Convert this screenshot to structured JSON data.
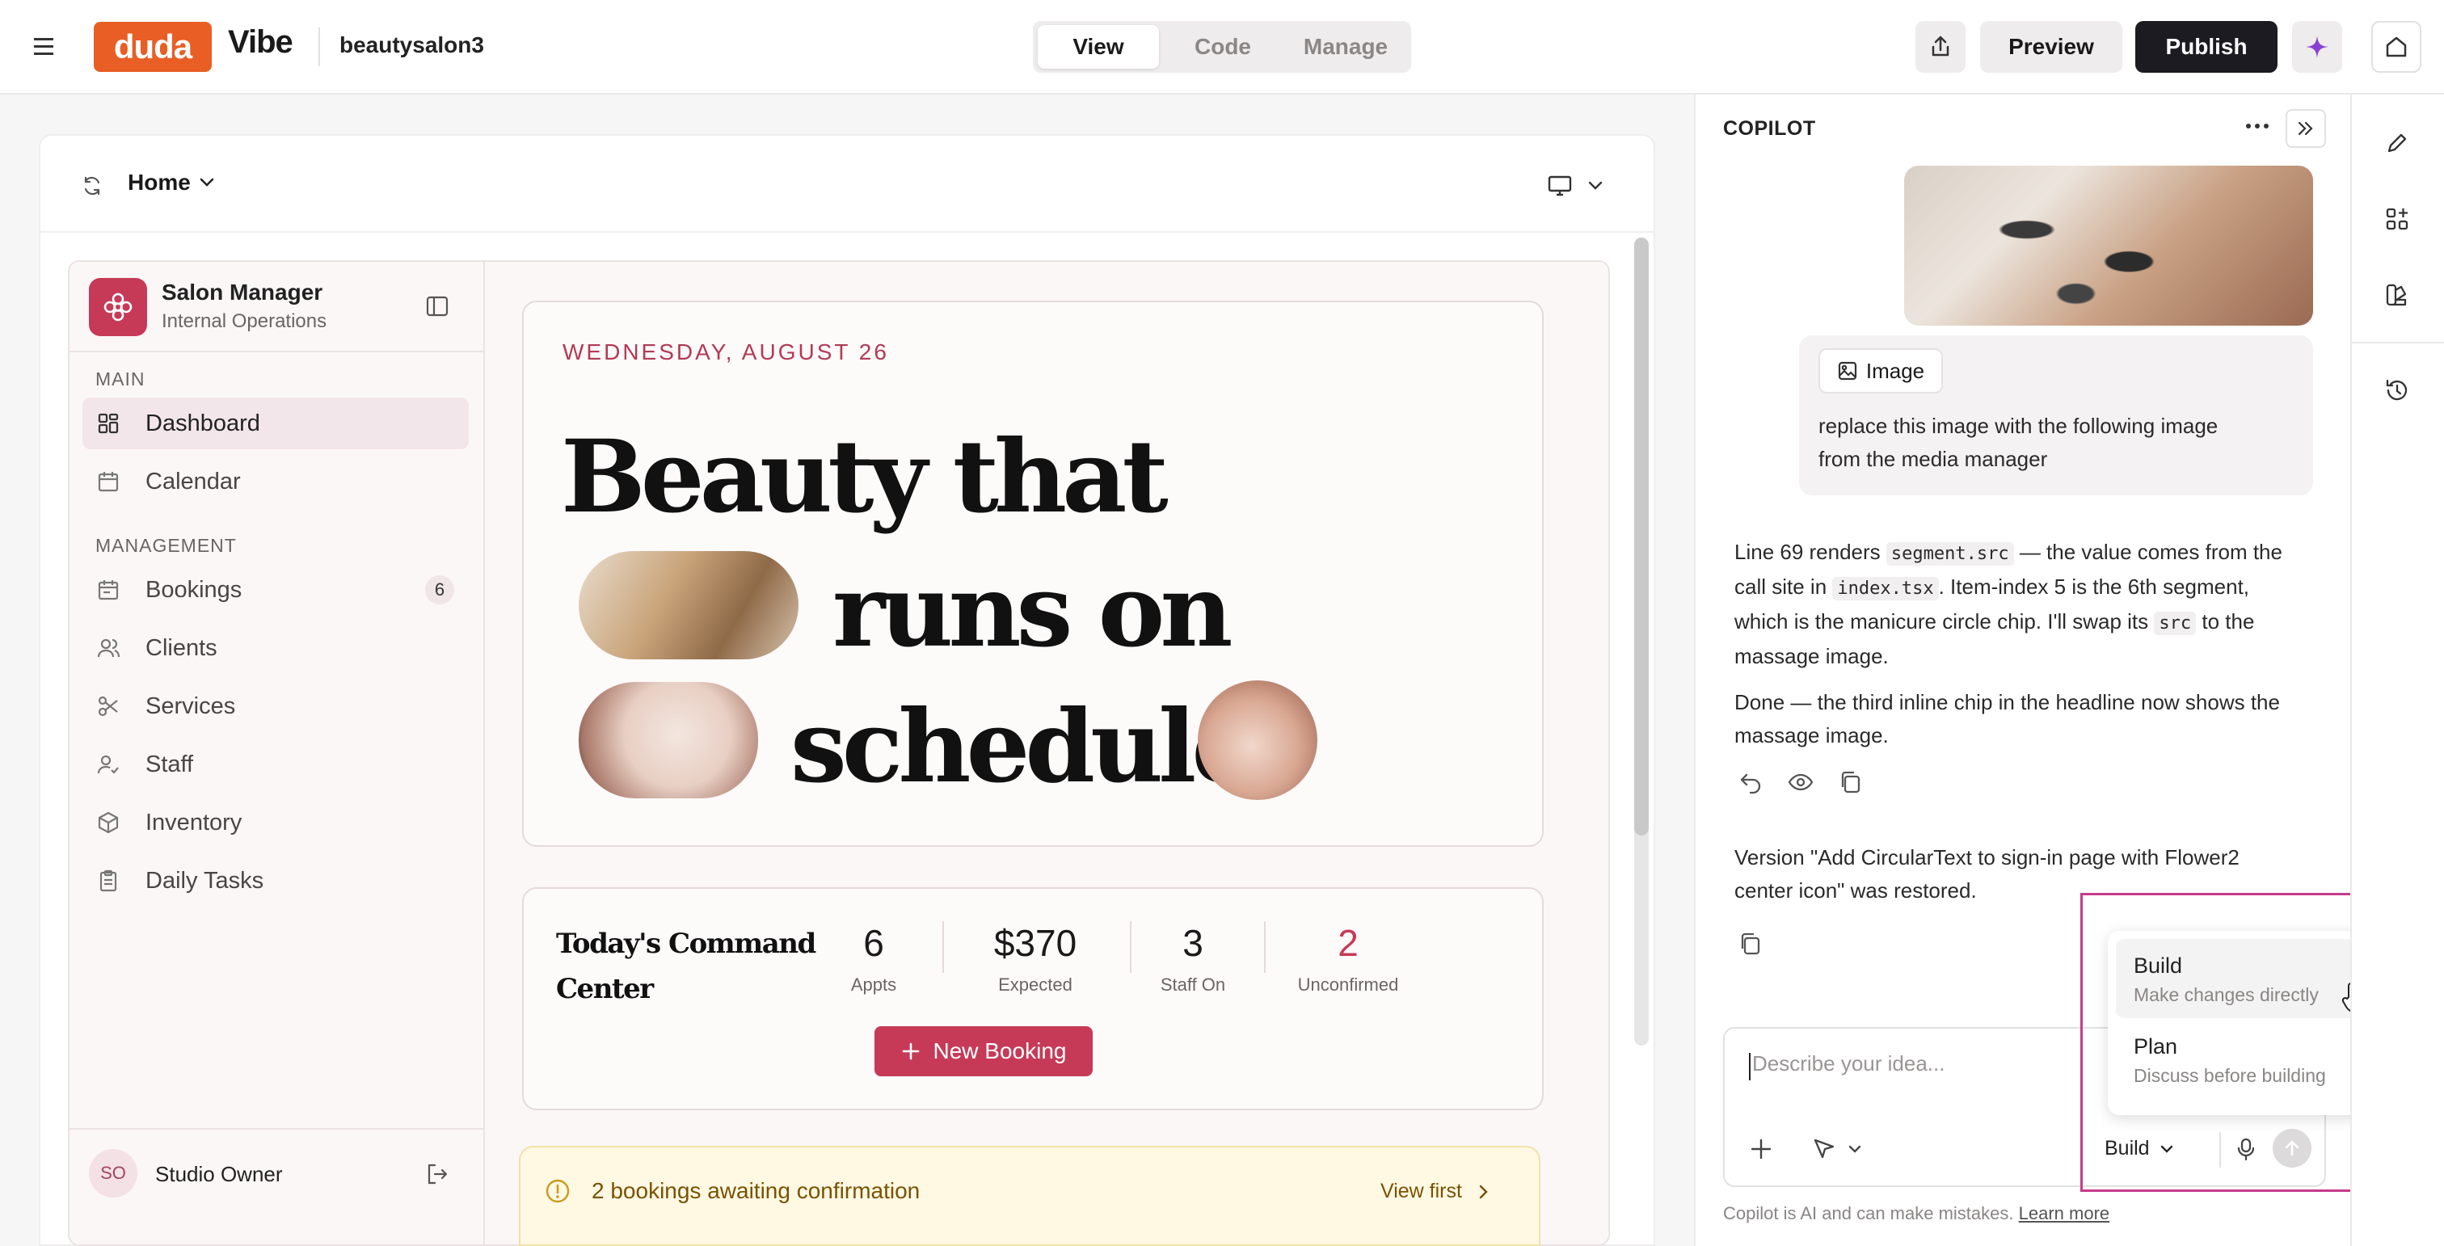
{
  "topbar": {
    "logo": "duda",
    "product": "Vibe",
    "project_name": "beautysalon3",
    "tabs": [
      {
        "label": "View",
        "active": true
      },
      {
        "label": "Code",
        "active": false
      },
      {
        "label": "Manage",
        "active": false
      }
    ],
    "preview_label": "Preview",
    "publish_label": "Publish"
  },
  "preview": {
    "page_select": "Home",
    "app": {
      "name": "Salon Manager",
      "subtitle": "Internal Operations",
      "sections": [
        {
          "label": "MAIN",
          "items": [
            {
              "label": "Dashboard",
              "icon": "dashboard-icon",
              "active": true
            },
            {
              "label": "Calendar",
              "icon": "calendar-icon"
            }
          ]
        },
        {
          "label": "MANAGEMENT",
          "items": [
            {
              "label": "Bookings",
              "icon": "bookings-icon",
              "badge": "6"
            },
            {
              "label": "Clients",
              "icon": "clients-icon"
            },
            {
              "label": "Services",
              "icon": "scissors-icon"
            },
            {
              "label": "Staff",
              "icon": "staff-icon"
            },
            {
              "label": "Inventory",
              "icon": "box-icon"
            },
            {
              "label": "Daily Tasks",
              "icon": "clipboard-icon"
            }
          ]
        }
      ],
      "user_initials": "SO",
      "user_name": "Studio Owner"
    },
    "hero": {
      "date": "WEDNESDAY, AUGUST 26",
      "line1": "Beauty that",
      "line2": "runs on",
      "line3": "schedule"
    },
    "command_center": {
      "title_line1": "Today's Command",
      "title_line2": "Center",
      "stats": [
        {
          "value": "6",
          "label": "Appts"
        },
        {
          "value": "$370",
          "label": "Expected"
        },
        {
          "value": "3",
          "label": "Staff On"
        },
        {
          "value": "2",
          "label": "Unconfirmed",
          "color": "#c63a58"
        }
      ],
      "new_booking_label": "New Booking"
    },
    "alert": {
      "text": "2 bookings awaiting confirmation",
      "action": "View first"
    }
  },
  "copilot": {
    "title": "COPILOT",
    "user_message": {
      "attachment_label": "Image",
      "text_line1": "replace this image with the following image",
      "text_line2": "from the media manager"
    },
    "assistant_1": {
      "l1a": "Line 69 renders ",
      "l1code": "segment.src",
      "l1b": " — the value comes from the",
      "l2a": "call site in ",
      "l2code": "index.tsx",
      "l2b": ". Item-index 5 is the 6th segment,",
      "l3a": "which is the manicure circle chip. I'll swap its ",
      "l3code": "src",
      "l3b": " to the",
      "l4": "massage image.",
      "l5": "Done — the third inline chip in the headline now shows the",
      "l6": "massage image."
    },
    "assistant_2": {
      "l1": "Version \"Add CircularText to sign-in page with Flower2",
      "l2": "center icon\" was restored."
    },
    "input_placeholder": "Describe your idea...",
    "mode_label": "Build",
    "mode_menu": [
      {
        "title": "Build",
        "subtitle": "Make changes directly",
        "active": true
      },
      {
        "title": "Plan",
        "subtitle": "Discuss before building",
        "active": false
      }
    ],
    "footer_text": "Copilot is AI and can make mistakes. ",
    "footer_link": "Learn more"
  },
  "colors": {
    "accent": "#c63a58",
    "brand_orange": "#e85e24",
    "dark_button": "#1c1b22",
    "highlight": "#c73b8b",
    "alert_bg": "#fff8e3",
    "alert_text": "#8a5a00"
  }
}
